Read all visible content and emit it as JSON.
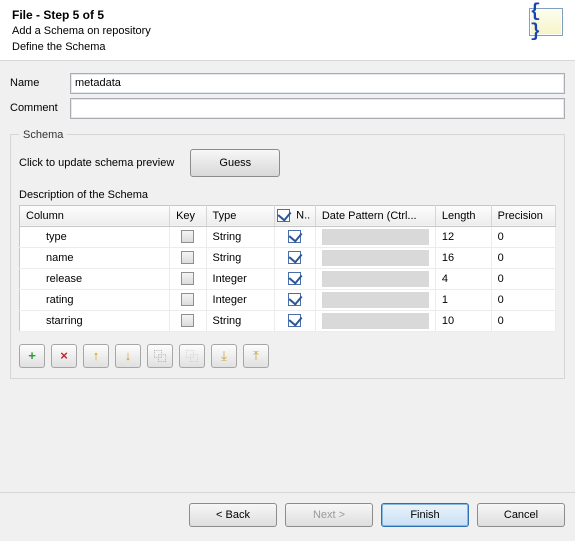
{
  "banner": {
    "title": "File - Step 5 of 5",
    "sub1": "Add a Schema on repository",
    "sub2": "Define the Schema"
  },
  "fields": {
    "name_label": "Name",
    "name_value": "metadata",
    "comment_label": "Comment",
    "comment_value": ""
  },
  "schema": {
    "legend": "Schema",
    "hint": "Click to update schema preview",
    "guess_label": "Guess",
    "desc": "Description of the Schema",
    "headers": {
      "column": "Column",
      "key": "Key",
      "type": "Type",
      "n": "N..",
      "date": "Date Pattern (Ctrl...",
      "length": "Length",
      "precision": "Precision"
    },
    "rows": [
      {
        "column": "type",
        "key": false,
        "type": "String",
        "n": true,
        "length": "12",
        "precision": "0"
      },
      {
        "column": "name",
        "key": false,
        "type": "String",
        "n": true,
        "length": "16",
        "precision": "0"
      },
      {
        "column": "release",
        "key": false,
        "type": "Integer",
        "n": true,
        "length": "4",
        "precision": "0"
      },
      {
        "column": "rating",
        "key": false,
        "type": "Integer",
        "n": true,
        "length": "1",
        "precision": "0"
      },
      {
        "column": "starring",
        "key": false,
        "type": "String",
        "n": true,
        "length": "10",
        "precision": "0"
      }
    ]
  },
  "toolbar": {
    "add": "+",
    "remove": "×",
    "up": "↑",
    "down": "↓",
    "copy": "⿻",
    "paste": "⿻",
    "import": "⤓",
    "export": "⤒"
  },
  "wizard": {
    "back": "< Back",
    "next": "Next >",
    "finish": "Finish",
    "cancel": "Cancel"
  },
  "colors": {
    "add": "#2e9b2e",
    "remove": "#c1272d",
    "arrow": "#d49b00",
    "io": "#caa23a"
  }
}
